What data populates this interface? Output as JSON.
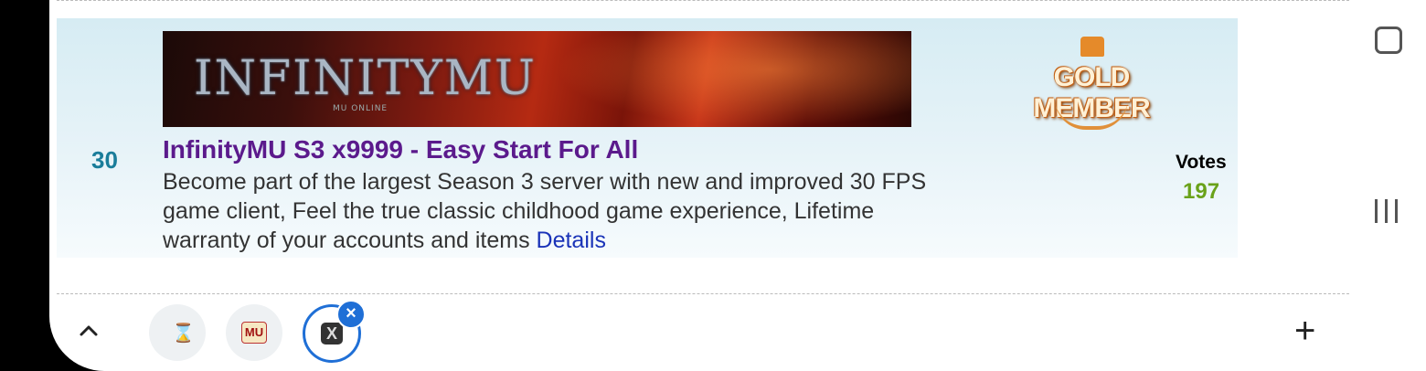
{
  "listing": {
    "rank": "30",
    "banner": {
      "logo_text": "INFINITYMU",
      "tagline": "MU ONLINE"
    },
    "title": "InfinityMU S3 x9999 - Easy Start For All",
    "description": "Become part of the largest Season 3 server with new and improved 30 FPS game client, Feel the true classic childhood game experience, Lifetime warranty of your accounts and items",
    "details_link": "Details",
    "badge": "GOLD MEMBER",
    "votes_label": "Votes",
    "votes_value": "197"
  },
  "tabbar": {
    "tabs": [
      {
        "icon": "hourglass-favicon"
      },
      {
        "icon": "mu-favicon",
        "text": "MU"
      },
      {
        "icon": "x-favicon",
        "text": "X",
        "active": true
      }
    ]
  },
  "colors": {
    "rank": "#1a7d9a",
    "title": "#5b1a8c",
    "votes": "#6aa21a",
    "link": "#1a33b8",
    "active_tab": "#1f6fd6"
  }
}
